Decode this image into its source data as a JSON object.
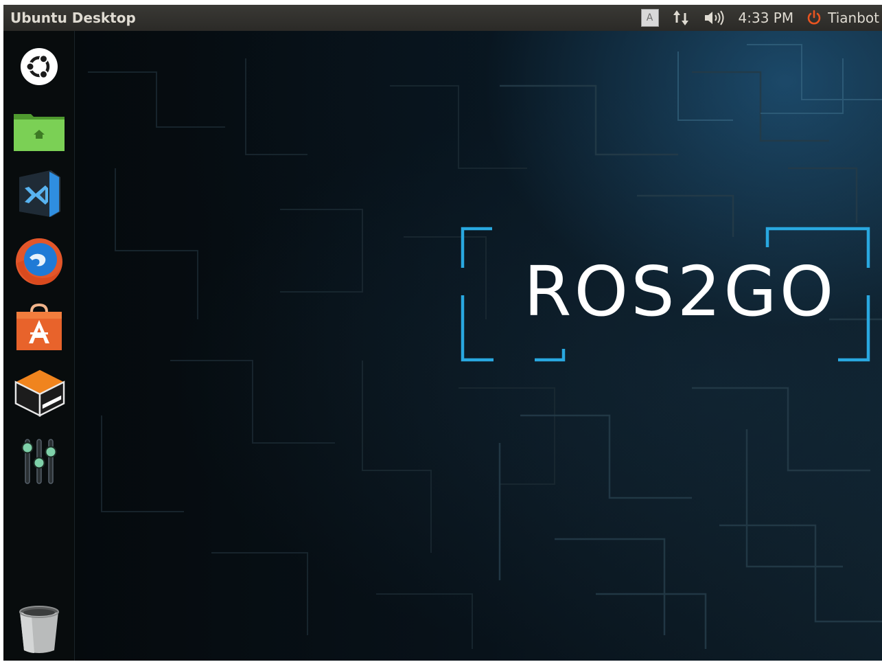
{
  "top_panel": {
    "window_title": "Ubuntu Desktop",
    "keyboard_layout": "A",
    "network_icon": "network-updown-icon",
    "volume_icon": "volume-icon",
    "clock": "4:33 PM",
    "session_icon": "power-icon",
    "user_name": "Tianbot"
  },
  "launcher": {
    "items": [
      {
        "name": "Ubuntu Dash",
        "icon": "ubuntu-logo-icon"
      },
      {
        "name": "Home Folder",
        "icon": "home-folder-icon"
      },
      {
        "name": "Visual Studio Code",
        "icon": "vscode-icon"
      },
      {
        "name": "Firefox Web Browser",
        "icon": "firefox-icon"
      },
      {
        "name": "Ubuntu Software",
        "icon": "software-center-icon"
      },
      {
        "name": "Workspace Switcher",
        "icon": "workspace-switcher-icon"
      },
      {
        "name": "System Settings",
        "icon": "settings-sliders-icon"
      },
      {
        "name": "Trash",
        "icon": "trash-icon"
      }
    ]
  },
  "wallpaper": {
    "brand": "ROS2GO",
    "accent_color": "#29a8e0"
  },
  "colors": {
    "panel_bg": "#2b2a27",
    "panel_text": "#dfdbd2",
    "power_icon": "#e95420",
    "desktop_bg": "#050a0e"
  }
}
